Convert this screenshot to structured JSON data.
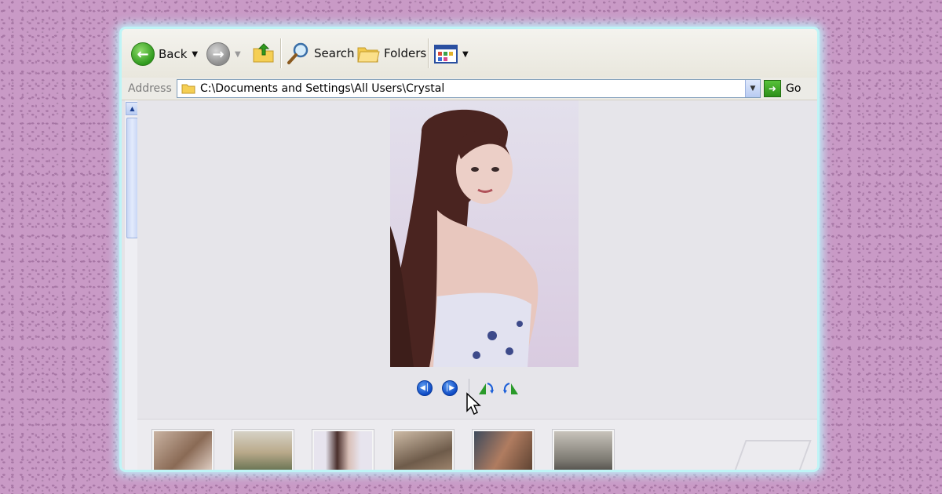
{
  "toolbar": {
    "back_label": "Back",
    "search_label": "Search",
    "folders_label": "Folders"
  },
  "address": {
    "label": "Address",
    "path": "C:\\Documents and Settings\\All Users\\Crystal",
    "go_label": "Go"
  },
  "icons": {
    "back": "back-arrow-icon",
    "forward": "forward-arrow-icon",
    "up": "folder-up-icon",
    "search": "magnifier-icon",
    "folders": "folders-icon",
    "views": "views-icon"
  },
  "thumbnails": [
    {
      "name": "thumb-1",
      "colors": [
        "#8a6a55",
        "#c9b3a2"
      ]
    },
    {
      "name": "thumb-2",
      "colors": [
        "#5c6b4a",
        "#b9a98a"
      ]
    },
    {
      "name": "thumb-3",
      "colors": [
        "#e7e4ee",
        "#4a2f2c"
      ]
    },
    {
      "name": "thumb-4",
      "colors": [
        "#6e5b4a",
        "#cdbba6"
      ]
    },
    {
      "name": "thumb-5",
      "colors": [
        "#3e4a5c",
        "#b07c60"
      ]
    },
    {
      "name": "thumb-6",
      "colors": [
        "#7a7770",
        "#c8c3bb"
      ]
    }
  ]
}
